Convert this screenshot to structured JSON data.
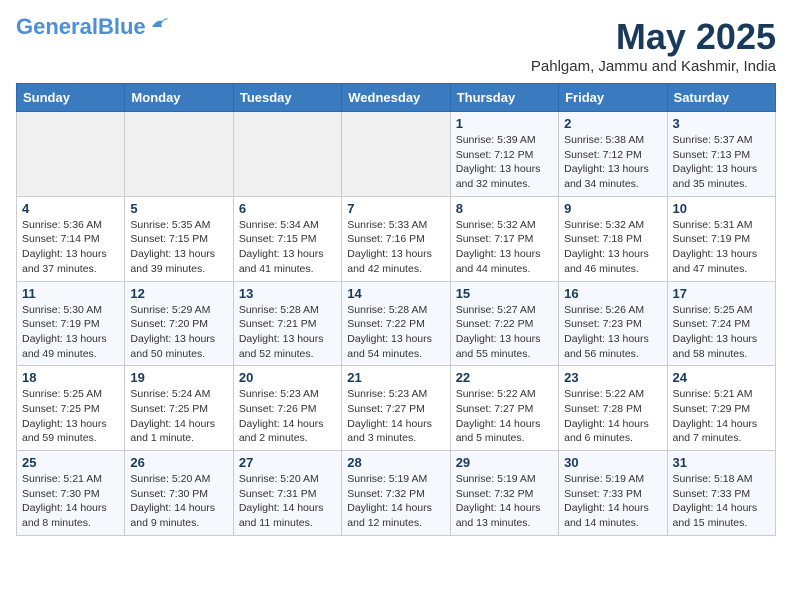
{
  "header": {
    "logo_general": "General",
    "logo_blue": "Blue",
    "month_title": "May 2025",
    "location": "Pahlgam, Jammu and Kashmir, India"
  },
  "weekdays": [
    "Sunday",
    "Monday",
    "Tuesday",
    "Wednesday",
    "Thursday",
    "Friday",
    "Saturday"
  ],
  "weeks": [
    [
      {
        "num": "",
        "info": ""
      },
      {
        "num": "",
        "info": ""
      },
      {
        "num": "",
        "info": ""
      },
      {
        "num": "",
        "info": ""
      },
      {
        "num": "1",
        "info": "Sunrise: 5:39 AM\nSunset: 7:12 PM\nDaylight: 13 hours\nand 32 minutes."
      },
      {
        "num": "2",
        "info": "Sunrise: 5:38 AM\nSunset: 7:12 PM\nDaylight: 13 hours\nand 34 minutes."
      },
      {
        "num": "3",
        "info": "Sunrise: 5:37 AM\nSunset: 7:13 PM\nDaylight: 13 hours\nand 35 minutes."
      }
    ],
    [
      {
        "num": "4",
        "info": "Sunrise: 5:36 AM\nSunset: 7:14 PM\nDaylight: 13 hours\nand 37 minutes."
      },
      {
        "num": "5",
        "info": "Sunrise: 5:35 AM\nSunset: 7:15 PM\nDaylight: 13 hours\nand 39 minutes."
      },
      {
        "num": "6",
        "info": "Sunrise: 5:34 AM\nSunset: 7:15 PM\nDaylight: 13 hours\nand 41 minutes."
      },
      {
        "num": "7",
        "info": "Sunrise: 5:33 AM\nSunset: 7:16 PM\nDaylight: 13 hours\nand 42 minutes."
      },
      {
        "num": "8",
        "info": "Sunrise: 5:32 AM\nSunset: 7:17 PM\nDaylight: 13 hours\nand 44 minutes."
      },
      {
        "num": "9",
        "info": "Sunrise: 5:32 AM\nSunset: 7:18 PM\nDaylight: 13 hours\nand 46 minutes."
      },
      {
        "num": "10",
        "info": "Sunrise: 5:31 AM\nSunset: 7:19 PM\nDaylight: 13 hours\nand 47 minutes."
      }
    ],
    [
      {
        "num": "11",
        "info": "Sunrise: 5:30 AM\nSunset: 7:19 PM\nDaylight: 13 hours\nand 49 minutes."
      },
      {
        "num": "12",
        "info": "Sunrise: 5:29 AM\nSunset: 7:20 PM\nDaylight: 13 hours\nand 50 minutes."
      },
      {
        "num": "13",
        "info": "Sunrise: 5:28 AM\nSunset: 7:21 PM\nDaylight: 13 hours\nand 52 minutes."
      },
      {
        "num": "14",
        "info": "Sunrise: 5:28 AM\nSunset: 7:22 PM\nDaylight: 13 hours\nand 54 minutes."
      },
      {
        "num": "15",
        "info": "Sunrise: 5:27 AM\nSunset: 7:22 PM\nDaylight: 13 hours\nand 55 minutes."
      },
      {
        "num": "16",
        "info": "Sunrise: 5:26 AM\nSunset: 7:23 PM\nDaylight: 13 hours\nand 56 minutes."
      },
      {
        "num": "17",
        "info": "Sunrise: 5:25 AM\nSunset: 7:24 PM\nDaylight: 13 hours\nand 58 minutes."
      }
    ],
    [
      {
        "num": "18",
        "info": "Sunrise: 5:25 AM\nSunset: 7:25 PM\nDaylight: 13 hours\nand 59 minutes."
      },
      {
        "num": "19",
        "info": "Sunrise: 5:24 AM\nSunset: 7:25 PM\nDaylight: 14 hours\nand 1 minute."
      },
      {
        "num": "20",
        "info": "Sunrise: 5:23 AM\nSunset: 7:26 PM\nDaylight: 14 hours\nand 2 minutes."
      },
      {
        "num": "21",
        "info": "Sunrise: 5:23 AM\nSunset: 7:27 PM\nDaylight: 14 hours\nand 3 minutes."
      },
      {
        "num": "22",
        "info": "Sunrise: 5:22 AM\nSunset: 7:27 PM\nDaylight: 14 hours\nand 5 minutes."
      },
      {
        "num": "23",
        "info": "Sunrise: 5:22 AM\nSunset: 7:28 PM\nDaylight: 14 hours\nand 6 minutes."
      },
      {
        "num": "24",
        "info": "Sunrise: 5:21 AM\nSunset: 7:29 PM\nDaylight: 14 hours\nand 7 minutes."
      }
    ],
    [
      {
        "num": "25",
        "info": "Sunrise: 5:21 AM\nSunset: 7:30 PM\nDaylight: 14 hours\nand 8 minutes."
      },
      {
        "num": "26",
        "info": "Sunrise: 5:20 AM\nSunset: 7:30 PM\nDaylight: 14 hours\nand 9 minutes."
      },
      {
        "num": "27",
        "info": "Sunrise: 5:20 AM\nSunset: 7:31 PM\nDaylight: 14 hours\nand 11 minutes."
      },
      {
        "num": "28",
        "info": "Sunrise: 5:19 AM\nSunset: 7:32 PM\nDaylight: 14 hours\nand 12 minutes."
      },
      {
        "num": "29",
        "info": "Sunrise: 5:19 AM\nSunset: 7:32 PM\nDaylight: 14 hours\nand 13 minutes."
      },
      {
        "num": "30",
        "info": "Sunrise: 5:19 AM\nSunset: 7:33 PM\nDaylight: 14 hours\nand 14 minutes."
      },
      {
        "num": "31",
        "info": "Sunrise: 5:18 AM\nSunset: 7:33 PM\nDaylight: 14 hours\nand 15 minutes."
      }
    ]
  ]
}
